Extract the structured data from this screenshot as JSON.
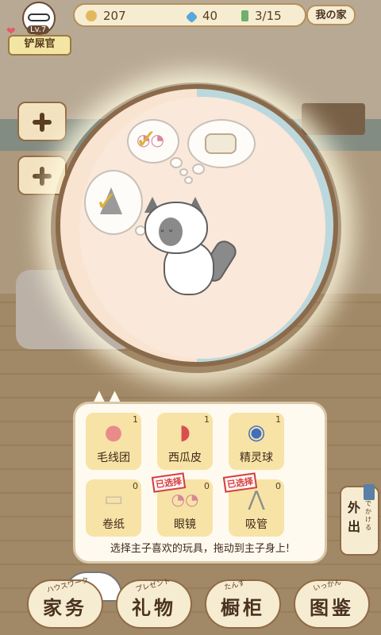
{
  "status_bar": {
    "level": "Lv.7",
    "user_title": "铲屎官",
    "coins": "207",
    "gems": "40",
    "progress": "3/15",
    "home_button": "我の家"
  },
  "toy_panel": {
    "toys": [
      {
        "name": "毛线团",
        "count": "1",
        "icon": "yarn-ball-icon",
        "chosen": ""
      },
      {
        "name": "西瓜皮",
        "count": "1",
        "icon": "watermelon-rind-icon",
        "chosen": ""
      },
      {
        "name": "精灵球",
        "count": "1",
        "icon": "crystal-ball-icon",
        "chosen": ""
      },
      {
        "name": "卷纸",
        "count": "0",
        "icon": "toilet-paper-icon",
        "chosen": ""
      },
      {
        "name": "眼镜",
        "count": "0",
        "icon": "glasses-icon",
        "chosen": "已选择"
      },
      {
        "name": "吸管",
        "count": "0",
        "icon": "straw-icon",
        "chosen": "已选择"
      }
    ],
    "hint": "选择主子喜欢的玩具，拖动到主子身上!"
  },
  "side_button": {
    "label": "外出",
    "ruby": "でかける"
  },
  "bottom_nav": [
    {
      "label": "家务",
      "ruby": "ハウスワーク"
    },
    {
      "label": "礼物",
      "ruby": "プレゼント"
    },
    {
      "label": "橱柜",
      "ruby": "たんす"
    },
    {
      "label": "图鉴",
      "ruby": "いっかん"
    }
  ],
  "colors": {
    "accent": "#f7e3a5",
    "border": "#8f6b45",
    "check": "#e0b13a",
    "chosen_stamp": "#d43c3c"
  }
}
